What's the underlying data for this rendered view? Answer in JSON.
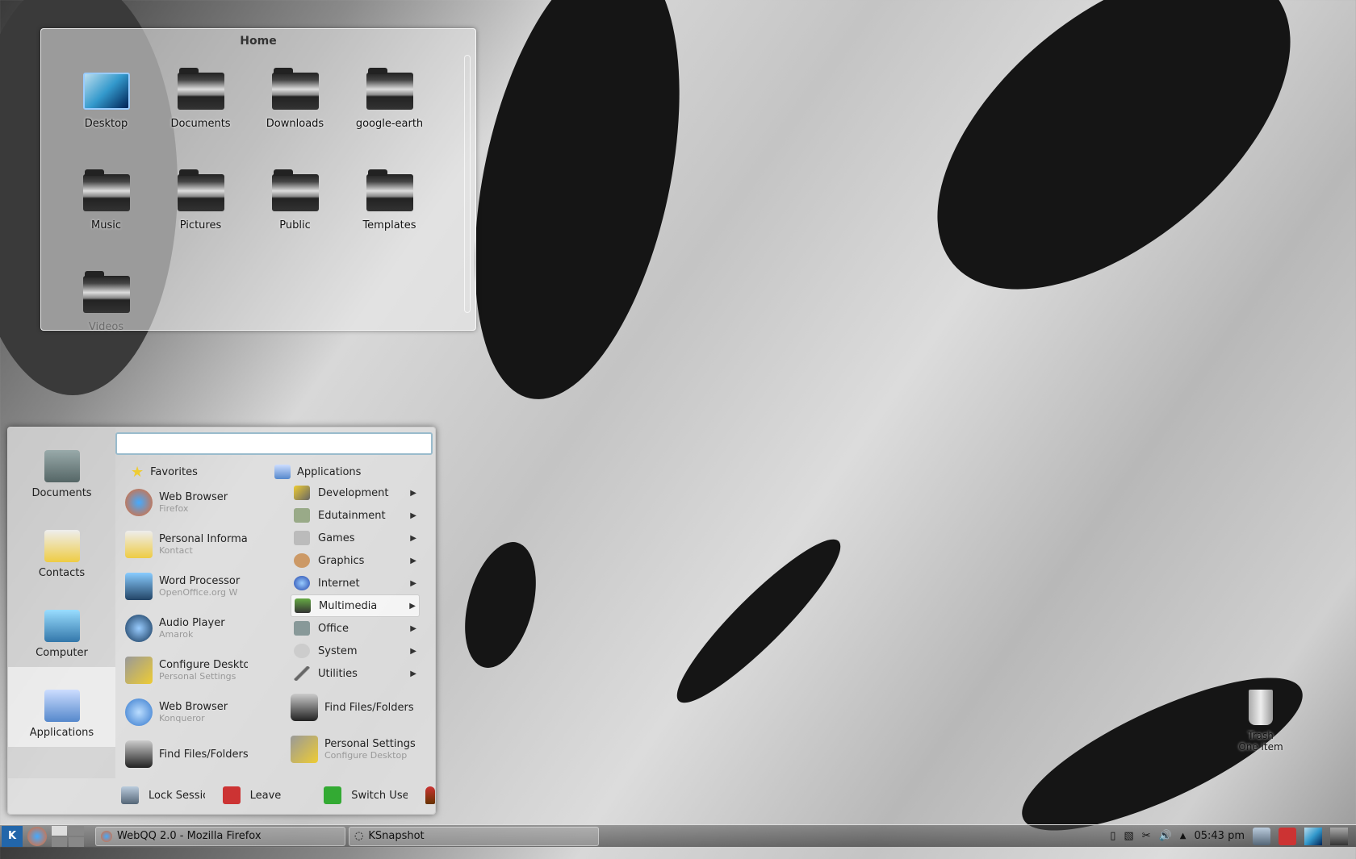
{
  "home_panel": {
    "title": "Home",
    "items": [
      "Desktop",
      "Documents",
      "Downloads",
      "google-earth",
      "Music",
      "Pictures",
      "Public",
      "Templates",
      "Videos"
    ]
  },
  "menu": {
    "search_placeholder": "",
    "left": [
      {
        "label": "Documents",
        "icon": "typewriter-icon"
      },
      {
        "label": "Contacts",
        "icon": "contacts-icon"
      },
      {
        "label": "Computer",
        "icon": "computer-icon"
      },
      {
        "label": "Applications",
        "icon": "applications-icon"
      }
    ],
    "tabs": {
      "favorites": "Favorites",
      "applications": "Applications"
    },
    "favorites": [
      {
        "title": "Web Browser",
        "sub": "Firefox"
      },
      {
        "title": "Personal Informa",
        "sub": "Kontact"
      },
      {
        "title": "Word Processor",
        "sub": "OpenOffice.org W"
      },
      {
        "title": "Audio Player",
        "sub": "Amarok"
      },
      {
        "title": "Configure Deskto",
        "sub": "Personal Settings"
      },
      {
        "title": "Web Browser",
        "sub": "Konqueror"
      },
      {
        "title": "Find Files/Folders",
        "sub": ""
      }
    ],
    "applications": [
      "Development",
      "Edutainment",
      "Games",
      "Graphics",
      "Internet",
      "Multimedia",
      "Office",
      "System",
      "Utilities"
    ],
    "selected_app": "Multimedia",
    "app_extra": [
      {
        "title": "Find Files/Folders",
        "sub": ""
      },
      {
        "title": "Personal Settings",
        "sub": "Configure Desktop"
      }
    ],
    "bottom": {
      "lock": "Lock Session",
      "leave": "Leave",
      "switch": "Switch User"
    }
  },
  "taskbar": {
    "tasks": [
      "WebQQ 2.0 - Mozilla Firefox",
      "KSnapshot"
    ],
    "clock": "05:43 pm"
  },
  "trash": {
    "label": "Trash",
    "count": "One item"
  },
  "colors": {
    "selection": "#ffffff",
    "accent": "#99bbcc"
  }
}
